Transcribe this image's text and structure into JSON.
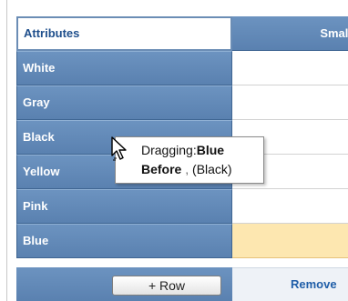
{
  "header": {
    "attributes_label": "Attributes",
    "column_label": "Small"
  },
  "rows": [
    {
      "label": "White"
    },
    {
      "label": "Gray"
    },
    {
      "label": "Black"
    },
    {
      "label": "Yellow"
    },
    {
      "label": "Pink"
    },
    {
      "label": "Blue",
      "highlighted": true
    }
  ],
  "footer": {
    "add_row_label": "+ Row",
    "remove_label": "Remove"
  },
  "tooltip": {
    "dragging_prefix": "Dragging:",
    "dragging_item": "Blue",
    "position_word": "Before",
    "separator": ",",
    "target": "(Black)"
  },
  "icons": {
    "cursor": "drag-arrow-cursor-icon"
  },
  "colors": {
    "header_blue": "#5a81b0",
    "highlight": "#fde7b0",
    "link_blue": "#1f5ea8"
  }
}
